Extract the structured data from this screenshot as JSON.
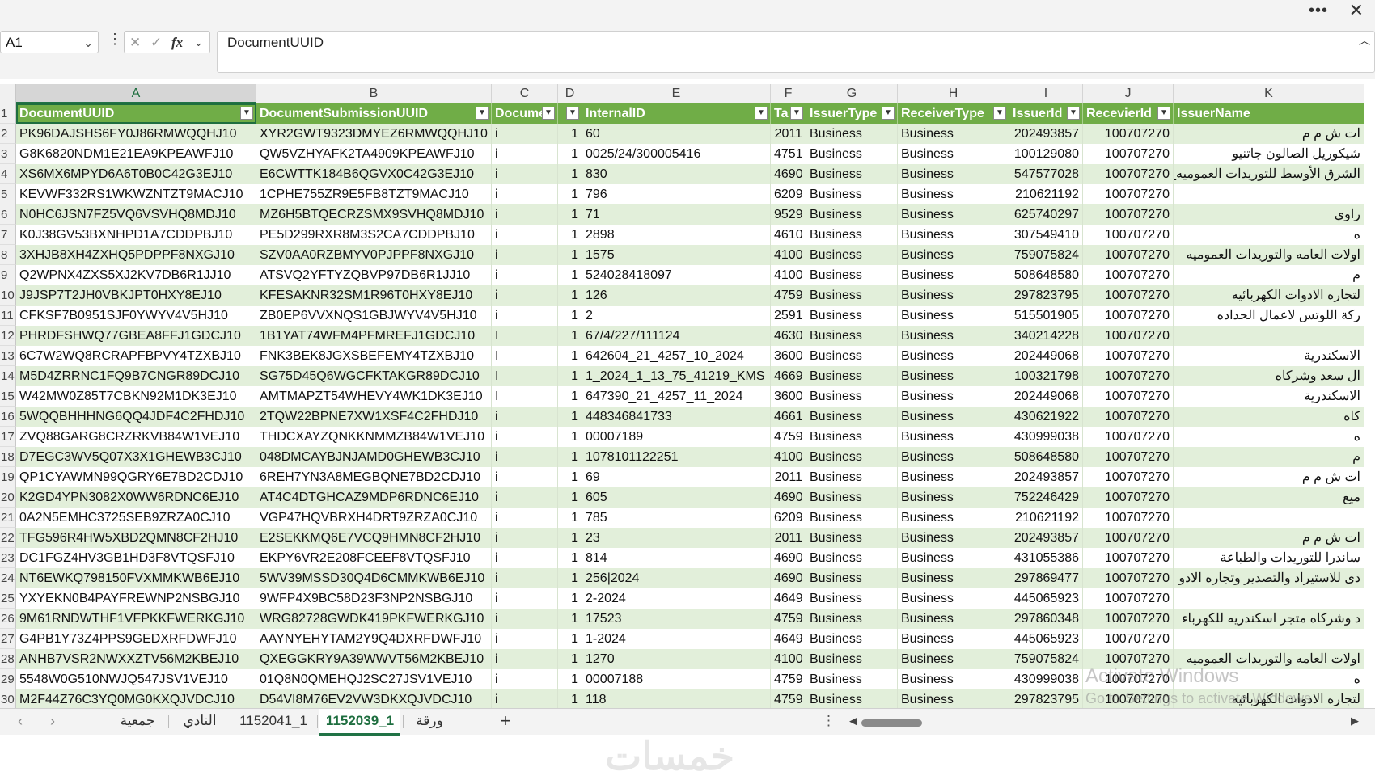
{
  "window": {
    "more_label": "•••",
    "close_label": "✕"
  },
  "formula_bar": {
    "name_box": "A1",
    "fx_label": "fx",
    "cancel_label": "✕",
    "enter_label": "✓",
    "formula": "DocumentUUID"
  },
  "column_letters": [
    "A",
    "B",
    "C",
    "D",
    "E",
    "F",
    "G",
    "H",
    "I",
    "J",
    "K"
  ],
  "headers": [
    "DocumentUUID",
    "DocumentSubmissionUUID",
    "Docume",
    "",
    "InternalID",
    "Ta",
    "IssuerType",
    "ReceiverType",
    "IssuerId",
    "RecevierId",
    "IssuerName"
  ],
  "rows": [
    {
      "n": "2",
      "a": "PK96DAJSHS6FY0J86RMWQQHJ10",
      "b": "XYR2GWT9323DMYEZ6RMWQQHJ10",
      "c": "i",
      "d": "1",
      "e": "60",
      "f": "2011",
      "g": "Business",
      "h": "Business",
      "i": "202493857",
      "j": "100707270",
      "k": "ات ش م م"
    },
    {
      "n": "3",
      "a": "G8K6820NDM1E21EA9KPEAWFJ10",
      "b": "QW5VZHYAFK2TA4909KPEAWFJ10",
      "c": "i",
      "d": "1",
      "e": "0025/24/300005416",
      "f": "4751",
      "g": "Business",
      "h": "Business",
      "i": "100129080",
      "j": "100707270",
      "k": "شيكوريل الصالون جاتنيو"
    },
    {
      "n": "4",
      "a": "XS6MX6MPYD6A6T0B0C42G3EJ10",
      "b": "E6CWTTK184B6QGVX0C42G3EJ10",
      "c": "i",
      "d": "1",
      "e": "830",
      "f": "4690",
      "g": "Business",
      "h": "Business",
      "i": "547577028",
      "j": "100707270",
      "k": "الشرق الأوسط للتوريدات العموميه_"
    },
    {
      "n": "5",
      "a": "KEVWF332RS1WKWZNTZT9MACJ10",
      "b": "1CPHE755ZR9E5FB8TZT9MACJ10",
      "c": "i",
      "d": "1",
      "e": "796",
      "f": "6209",
      "g": "Business",
      "h": "Business",
      "i": "210621192",
      "j": "100707270",
      "k": ""
    },
    {
      "n": "6",
      "a": "N0HC6JSN7FZ5VQ6VSVHQ8MDJ10",
      "b": "MZ6H5BTQECRZSMX9SVHQ8MDJ10",
      "c": "i",
      "d": "1",
      "e": "71",
      "f": "9529",
      "g": "Business",
      "h": "Business",
      "i": "625740297",
      "j": "100707270",
      "k": "راوي"
    },
    {
      "n": "7",
      "a": "K0J38GV53BXNHPD1A7CDDPBJ10",
      "b": "PE5D299RXR8M3S2CA7CDDPBJ10",
      "c": "i",
      "d": "1",
      "e": "2898",
      "f": "4610",
      "g": "Business",
      "h": "Business",
      "i": "307549410",
      "j": "100707270",
      "k": "ه"
    },
    {
      "n": "8",
      "a": "3XHJB8XH4ZXHQ5PDPPF8NXGJ10",
      "b": "SZV0AA0RZBMYV0PJPPF8NXGJ10",
      "c": "i",
      "d": "1",
      "e": "1575",
      "f": "4100",
      "g": "Business",
      "h": "Business",
      "i": "759075824",
      "j": "100707270",
      "k": "اولات العامه والتوريدات العموميه"
    },
    {
      "n": "9",
      "a": "Q2WPNX4ZXS5XJ2KV7DB6R1JJ10",
      "b": "ATSVQ2YFTYZQBVP97DB6R1JJ10",
      "c": "i",
      "d": "1",
      "e": "524028418097",
      "f": "4100",
      "g": "Business",
      "h": "Business",
      "i": "508648580",
      "j": "100707270",
      "k": "م"
    },
    {
      "n": "10",
      "a": "J9JSP7T2JH0VBKJPT0HXY8EJ10",
      "b": "KFESAKNR32SM1R96T0HXY8EJ10",
      "c": "i",
      "d": "1",
      "e": "126",
      "f": "4759",
      "g": "Business",
      "h": "Business",
      "i": "297823795",
      "j": "100707270",
      "k": "لتجاره الادوات الكهربائيه"
    },
    {
      "n": "11",
      "a": "CFKSF7B0951SJF0YWYV4V5HJ10",
      "b": "ZB0EP6VVXNQS1GBJWYV4V5HJ10",
      "c": "i",
      "d": "1",
      "e": "2",
      "f": "2591",
      "g": "Business",
      "h": "Business",
      "i": "515501905",
      "j": "100707270",
      "k": "ركة اللوتس لاعمال الحداده"
    },
    {
      "n": "12",
      "a": "PHRDFSHWQ77GBEA8FFJ1GDCJ10",
      "b": "1B1YAT74WFM4PFMREFJ1GDCJ10",
      "c": "I",
      "d": "1",
      "e": "67/4/227/111124",
      "f": "4630",
      "g": "Business",
      "h": "Business",
      "i": "340214228",
      "j": "100707270",
      "k": ""
    },
    {
      "n": "13",
      "a": "6C7W2WQ8RCRAPFBPVY4TZXBJ10",
      "b": "FNK3BEK8JGXSBEFEMY4TZXBJ10",
      "c": "I",
      "d": "1",
      "e": "642604_21_4257_10_2024",
      "f": "3600",
      "g": "Business",
      "h": "Business",
      "i": "202449068",
      "j": "100707270",
      "k": "الاسكندرية"
    },
    {
      "n": "14",
      "a": "M5D4ZRRNC1FQ9B7CNGR89DCJ10",
      "b": "SG75D45Q6WGCFKTAKGR89DCJ10",
      "c": "I",
      "d": "1",
      "e": "1_2024_1_13_75_41219_KMS",
      "f": "4669",
      "g": "Business",
      "h": "Business",
      "i": "100321798",
      "j": "100707270",
      "k": "ال سعد وشركاه"
    },
    {
      "n": "15",
      "a": "W42MW0Z85T7CBKN92M1DK3EJ10",
      "b": "AMTMAPZT54WHEVY4WK1DK3EJ10",
      "c": "I",
      "d": "1",
      "e": "647390_21_4257_11_2024",
      "f": "3600",
      "g": "Business",
      "h": "Business",
      "i": "202449068",
      "j": "100707270",
      "k": "الاسكندرية"
    },
    {
      "n": "16",
      "a": "5WQQBHHHNG6QQ4JDF4C2FHDJ10",
      "b": "2TQW22BPNE7XW1XSF4C2FHDJ10",
      "c": "i",
      "d": "1",
      "e": "448346841733",
      "f": "4661",
      "g": "Business",
      "h": "Business",
      "i": "430621922",
      "j": "100707270",
      "k": "كاه"
    },
    {
      "n": "17",
      "a": "ZVQ88GARG8CRZRKVB84W1VEJ10",
      "b": "THDCXAYZQNKKNMMZB84W1VEJ10",
      "c": "i",
      "d": "1",
      "e": "00007189",
      "f": "4759",
      "g": "Business",
      "h": "Business",
      "i": "430999038",
      "j": "100707270",
      "k": "ه"
    },
    {
      "n": "18",
      "a": "D7EGC3WV5Q07X3X1GHEWB3CJ10",
      "b": "048DMCAYBJNJAMD0GHEWB3CJ10",
      "c": "i",
      "d": "1",
      "e": "1078101122251",
      "f": "4100",
      "g": "Business",
      "h": "Business",
      "i": "508648580",
      "j": "100707270",
      "k": "م"
    },
    {
      "n": "19",
      "a": "QP1CYAWMN99QGRY6E7BD2CDJ10",
      "b": "6REH7YN3A8MEGBQNE7BD2CDJ10",
      "c": "i",
      "d": "1",
      "e": "69",
      "f": "2011",
      "g": "Business",
      "h": "Business",
      "i": "202493857",
      "j": "100707270",
      "k": "ات ش م م"
    },
    {
      "n": "20",
      "a": "K2GD4YPN3082X0WW6RDNC6EJ10",
      "b": "AT4C4DTGHCAZ9MDP6RDNC6EJ10",
      "c": "i",
      "d": "1",
      "e": "605",
      "f": "4690",
      "g": "Business",
      "h": "Business",
      "i": "752246429",
      "j": "100707270",
      "k": "ميع"
    },
    {
      "n": "21",
      "a": "0A2N5EMHC3725SEB9ZRZA0CJ10",
      "b": "VGP47HQVBRXH4DRT9ZRZA0CJ10",
      "c": "i",
      "d": "1",
      "e": "785",
      "f": "6209",
      "g": "Business",
      "h": "Business",
      "i": "210621192",
      "j": "100707270",
      "k": ""
    },
    {
      "n": "22",
      "a": "TFG596R4HW5XBD2QMN8CF2HJ10",
      "b": "E2SEKKMQ6E7VCQ9HMN8CF2HJ10",
      "c": "i",
      "d": "1",
      "e": "23",
      "f": "2011",
      "g": "Business",
      "h": "Business",
      "i": "202493857",
      "j": "100707270",
      "k": "ات ش م م"
    },
    {
      "n": "23",
      "a": "DC1FGZ4HV3GB1HD3F8VTQSFJ10",
      "b": "EKPY6VR2E208FCEEF8VTQSFJ10",
      "c": "i",
      "d": "1",
      "e": "814",
      "f": "4690",
      "g": "Business",
      "h": "Business",
      "i": "431055386",
      "j": "100707270",
      "k": "ساندرا للتوريدات والطباعة"
    },
    {
      "n": "24",
      "a": "NT6EWKQ798150FVXMMKWB6EJ10",
      "b": "5WV39MSSD30Q4D6CMMKWB6EJ10",
      "c": "i",
      "d": "1",
      "e": "256|2024",
      "f": "4690",
      "g": "Business",
      "h": "Business",
      "i": "297869477",
      "j": "100707270",
      "k": "دى للاستيراد والتصدير وتجاره الادو"
    },
    {
      "n": "25",
      "a": "YXYEKN0B4PAYFREWNP2NSBGJ10",
      "b": "9WFP4X9BC58D23F3NP2NSBGJ10",
      "c": "i",
      "d": "1",
      "e": "2-2024",
      "f": "4649",
      "g": "Business",
      "h": "Business",
      "i": "445065923",
      "j": "100707270",
      "k": ""
    },
    {
      "n": "26",
      "a": "9M61RNDWTHF1VFPKKFWERKGJ10",
      "b": "WRG82728GWDK419PKFWERKGJ10",
      "c": "i",
      "d": "1",
      "e": "17523",
      "f": "4759",
      "g": "Business",
      "h": "Business",
      "i": "297860348",
      "j": "100707270",
      "k": "د وشركاه متجر اسكندريه للكهرباء"
    },
    {
      "n": "27",
      "a": "G4PB1Y73Z4PPS9GEDXRFDWFJ10",
      "b": "AAYNYEHYTAM2Y9Q4DXRFDWFJ10",
      "c": "i",
      "d": "1",
      "e": "1-2024",
      "f": "4649",
      "g": "Business",
      "h": "Business",
      "i": "445065923",
      "j": "100707270",
      "k": ""
    },
    {
      "n": "28",
      "a": "ANHB7VSR2NWXXZTV56M2KBEJ10",
      "b": "QXEGGKRY9A39WWVT56M2KBEJ10",
      "c": "i",
      "d": "1",
      "e": "1270",
      "f": "4100",
      "g": "Business",
      "h": "Business",
      "i": "759075824",
      "j": "100707270",
      "k": "اولات العامه والتوريدات العموميه"
    },
    {
      "n": "29",
      "a": "5548W0G510NWJQ547JSV1VEJ10",
      "b": "01Q8N0QMEHQJ2SC27JSV1VEJ10",
      "c": "i",
      "d": "1",
      "e": "00007188",
      "f": "4759",
      "g": "Business",
      "h": "Business",
      "i": "430999038",
      "j": "100707270",
      "k": "ه"
    },
    {
      "n": "30",
      "a": "M2F44Z76C3YQ0MG0KXQJVDCJ10",
      "b": "D54VI8M76EV2VW3DKXQJVDCJ10",
      "c": "i",
      "d": "1",
      "e": "118",
      "f": "4759",
      "g": "Business",
      "h": "Business",
      "i": "297823795",
      "j": "100707270",
      "k": "لتجاره الادوات الكهربائيه"
    }
  ],
  "watermark": {
    "line1": "Activate Windows",
    "line2": "Go to Settings to activate Windows."
  },
  "sheet_tabs": [
    "جمعية",
    "النادي",
    "1152041_1",
    "1152039_1",
    "ورقة"
  ],
  "active_tab_index": 3,
  "add_sheet_label": "+",
  "tab_menu_label": "⋮",
  "nav_prev_label": "‹",
  "nav_next_label": "›",
  "scroll_left_label": "◀",
  "scroll_right_label": "▶",
  "footer_logo": "خمسات",
  "colors": {
    "header_green": "#70ad47",
    "band_green": "#e2efda",
    "accent": "#217346"
  }
}
